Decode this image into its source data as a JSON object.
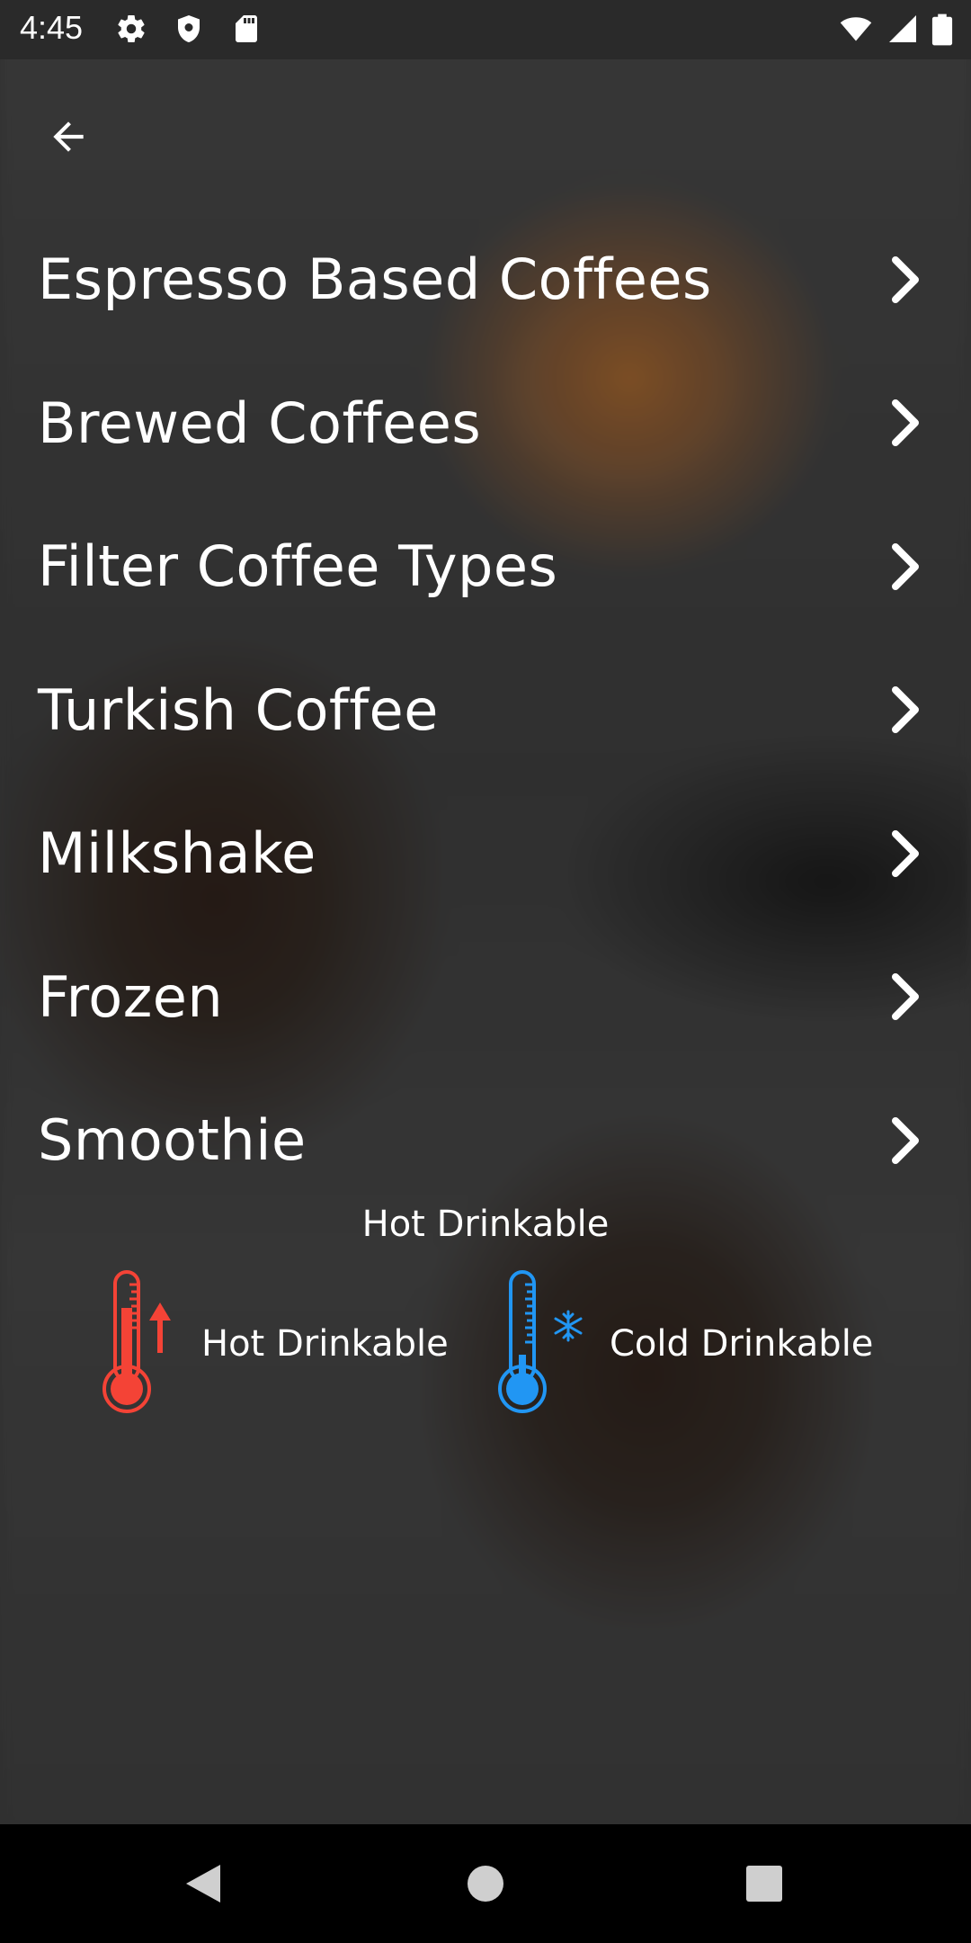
{
  "status_bar": {
    "time": "4:45",
    "left_icons": [
      "gear-icon",
      "shield-icon",
      "sd-card-icon"
    ],
    "right_icons": [
      "wifi-icon",
      "cell-signal-icon",
      "battery-icon"
    ]
  },
  "toolbar": {
    "back_icon": "arrow-left-icon"
  },
  "menu": {
    "items": [
      {
        "label": "Espresso Based Coffees"
      },
      {
        "label": "Brewed Coffees"
      },
      {
        "label": "Filter Coffee Types"
      },
      {
        "label": "Turkish Coffee"
      },
      {
        "label": "Milkshake"
      },
      {
        "label": "Frozen"
      },
      {
        "label": "Smoothie"
      }
    ],
    "chevron_icon": "chevron-right-icon"
  },
  "legend": {
    "title": "Hot Drinkable",
    "hot": {
      "label": "Hot Drinkable",
      "icon": "thermometer-hot-icon",
      "color": "#f44336"
    },
    "cold": {
      "label": "Cold Drinkable",
      "icon": "thermometer-cold-icon",
      "color": "#2196f3"
    }
  },
  "nav_bar": {
    "icons": [
      "nav-back-icon",
      "nav-home-icon",
      "nav-recents-icon"
    ]
  }
}
